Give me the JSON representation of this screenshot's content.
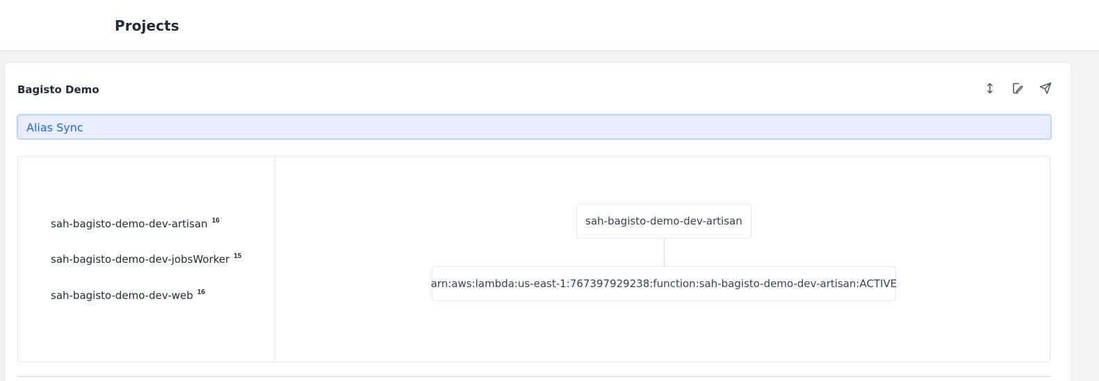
{
  "header": {
    "title": "Projects"
  },
  "project": {
    "name": "Bagisto Demo",
    "actions": [
      {
        "icon": "expand-vertical-icon"
      },
      {
        "icon": "edit-icon"
      },
      {
        "icon": "send-icon"
      }
    ]
  },
  "alias_sync": {
    "label": "Alias Sync"
  },
  "functions": [
    {
      "name": "sah-bagisto-demo-dev-artisan",
      "count": "16"
    },
    {
      "name": "sah-bagisto-demo-dev-jobsWorker",
      "count": "15"
    },
    {
      "name": "sah-bagisto-demo-dev-web",
      "count": "16"
    }
  ],
  "graph": {
    "root": "sah-bagisto-demo-dev-artisan",
    "child": "arn:aws:lambda:us-east-1:767397929238:function:sah-bagisto-demo-dev-artisan:ACTIVE"
  },
  "colors": {
    "accent": "#2563eb",
    "alias_bg": "#e7efff",
    "alias_border": "#bcd3fb"
  }
}
